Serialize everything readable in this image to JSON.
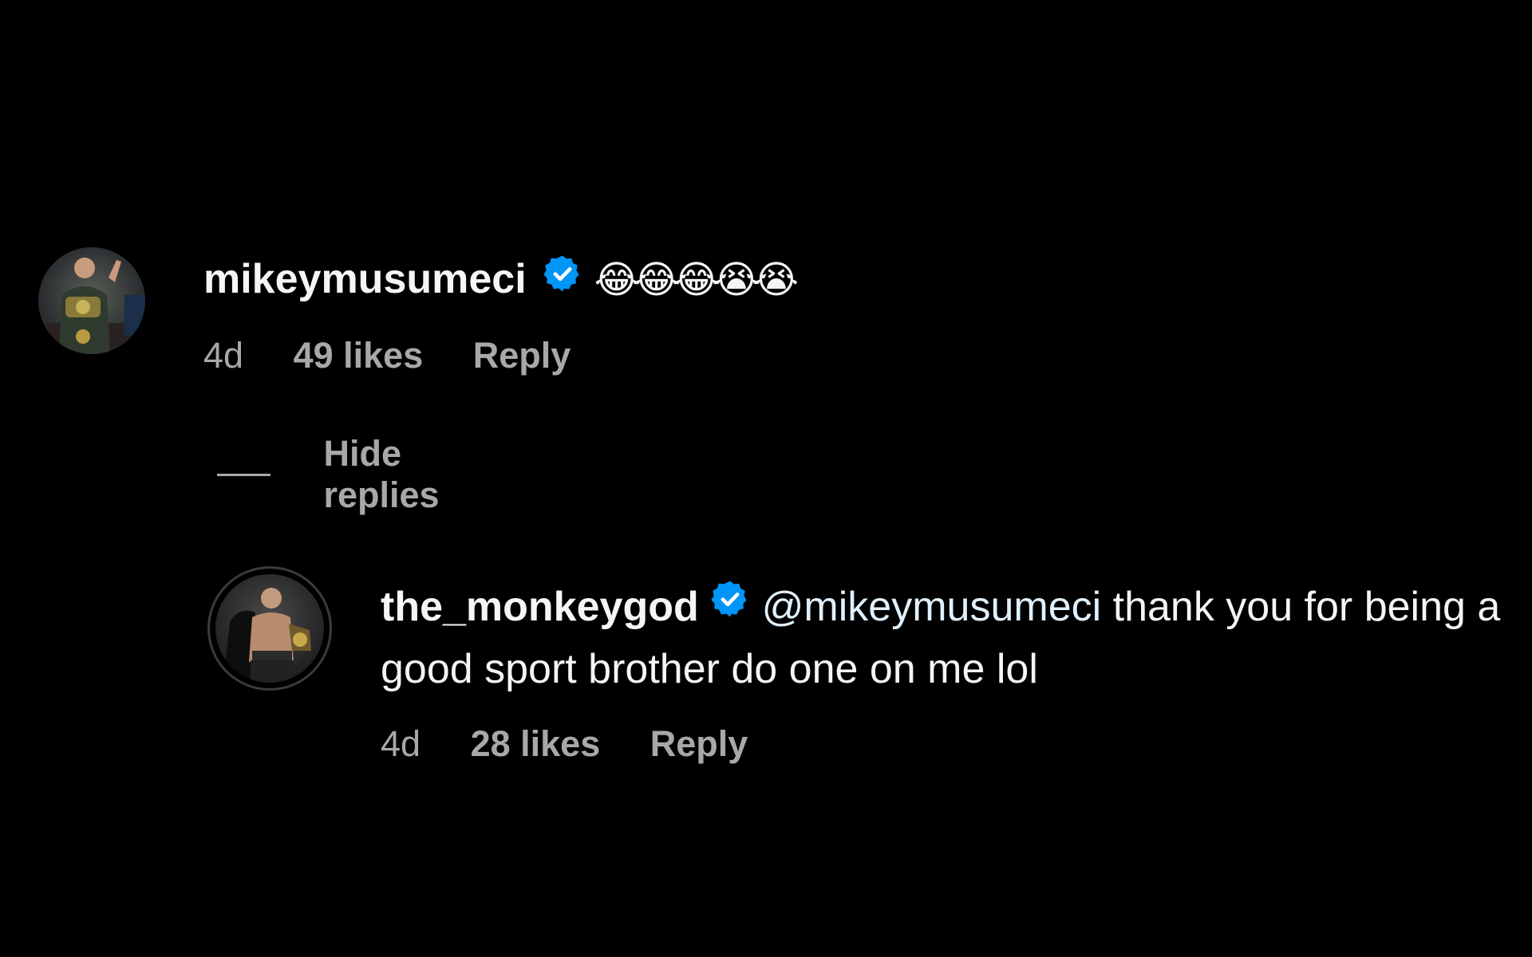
{
  "comment": {
    "username": "mikeymusumeci",
    "verified": true,
    "text": "😂😂😂😭😭",
    "time": "4d",
    "likes": "49 likes",
    "reply_label": "Reply",
    "hide_replies_label": "Hide replies"
  },
  "reply": {
    "username": "the_monkeygod",
    "verified": true,
    "mention": "@mikeymusumeci",
    "text": " thank you for being a good sport brother do one on me lol",
    "time": "4d",
    "likes": "28 likes",
    "reply_label": "Reply"
  },
  "colors": {
    "background": "#000000",
    "primary_text": "#f5f5f5",
    "secondary_text": "#a8a8a8",
    "verified_badge": "#0095f6",
    "mention": "#e0f1ff"
  },
  "icons": {
    "verified": "verified-badge-icon"
  }
}
